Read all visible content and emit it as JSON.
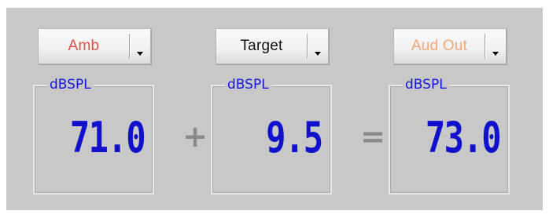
{
  "colors": {
    "panel_background": "#c8c8c8",
    "readout_value": "#1111cc",
    "readout_unit": "#1515d8",
    "operator": "#8a8a8a",
    "amb_label": "#e05050",
    "target_label": "#111111",
    "aud_out_label": "#f0a878"
  },
  "units": [
    {
      "dropdown": {
        "label": "Amb",
        "icon": "chevron-down-icon"
      },
      "readout": {
        "unit": "dBSPL",
        "value": "71.0"
      }
    },
    {
      "dropdown": {
        "label": "Target",
        "icon": "chevron-down-icon"
      },
      "readout": {
        "unit": "dBSPL",
        "value": "9.5"
      }
    },
    {
      "dropdown": {
        "label": "Aud Out",
        "icon": "chevron-down-icon"
      },
      "readout": {
        "unit": "dBSPL",
        "value": "73.0"
      }
    }
  ],
  "operators": {
    "plus": "+",
    "equals": "="
  }
}
